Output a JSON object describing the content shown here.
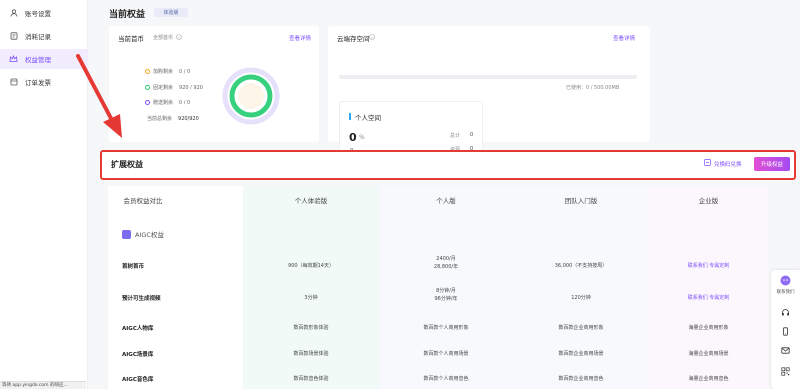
{
  "sidebar": {
    "items": [
      {
        "label": "账号设置",
        "icon": "user-icon"
      },
      {
        "label": "消耗记录",
        "icon": "record-icon"
      },
      {
        "label": "权益管理",
        "icon": "crown-icon"
      },
      {
        "label": "订单发票",
        "icon": "invoice-icon"
      }
    ]
  },
  "page": {
    "title": "当前权益",
    "tier_badge": "体验版"
  },
  "rights_card": {
    "title": "当前首币",
    "subtitle": "全部首币",
    "detail_link": "查看详情",
    "legend": [
      {
        "label": "加购剩余",
        "value": "0 / 0",
        "color": "#f5a623"
      },
      {
        "label": "固定剩余",
        "value": "920 / 920",
        "color": "#2ecc71"
      },
      {
        "label": "赠送剩余",
        "value": "0 / 0",
        "color": "#7c4dff"
      }
    ],
    "total_label": "当前总剩余",
    "total_value": "920/920"
  },
  "storage_card": {
    "title": "云端存空间",
    "detail_link": "查看详情",
    "usage_text": "已使用：0 / 500.00MB",
    "usage_fraction": 0,
    "personal_title": "个人空间",
    "percent_value": "0",
    "percent_unit": "%",
    "sub_value": "0",
    "stats": [
      {
        "label": "总计",
        "value": "0"
      },
      {
        "label": "资源",
        "value": "0"
      }
    ]
  },
  "extension": {
    "title": "扩展权益",
    "redeem_label": "兑换码兑换",
    "upgrade_label": "升级权益"
  },
  "table": {
    "headers": [
      "会员权益对比",
      "个人体验版",
      "个人版",
      "团队入门版",
      "企业版"
    ],
    "section_title": "AIGC权益",
    "rows": [
      {
        "label": "首树首币",
        "cells": [
          "900（每效期14天）",
          "2400/月\n28,800/年",
          "36,000（不支持按周）",
          "联系我们 专属定制"
        ]
      },
      {
        "label": "预计可生成视频",
        "cells": [
          "3分钟",
          "8分钟/月\n96分钟/年",
          "120分钟",
          "联系我们 专属定制"
        ]
      },
      {
        "label": "AIGC人物库",
        "cells": [
          "数百款形象体验",
          "数百款个人商用形象",
          "数百款企业商用形象",
          "海量企业商用形象"
        ]
      },
      {
        "label": "AIGC场景库",
        "cells": [
          "数百款场景体验",
          "数百款个人商用场景",
          "数百款企业商用场景",
          "海量企业商用场景"
        ]
      },
      {
        "label": "AIGC音色库",
        "cells": [
          "数百款音色体验",
          "数百款个人商用音色",
          "数百款企业商用音色",
          "海量企业商用音色"
        ]
      }
    ]
  },
  "float_bar": {
    "contact_label": "联系我们"
  },
  "statusbar": "等待 app.yingdo.com 的响应..."
}
